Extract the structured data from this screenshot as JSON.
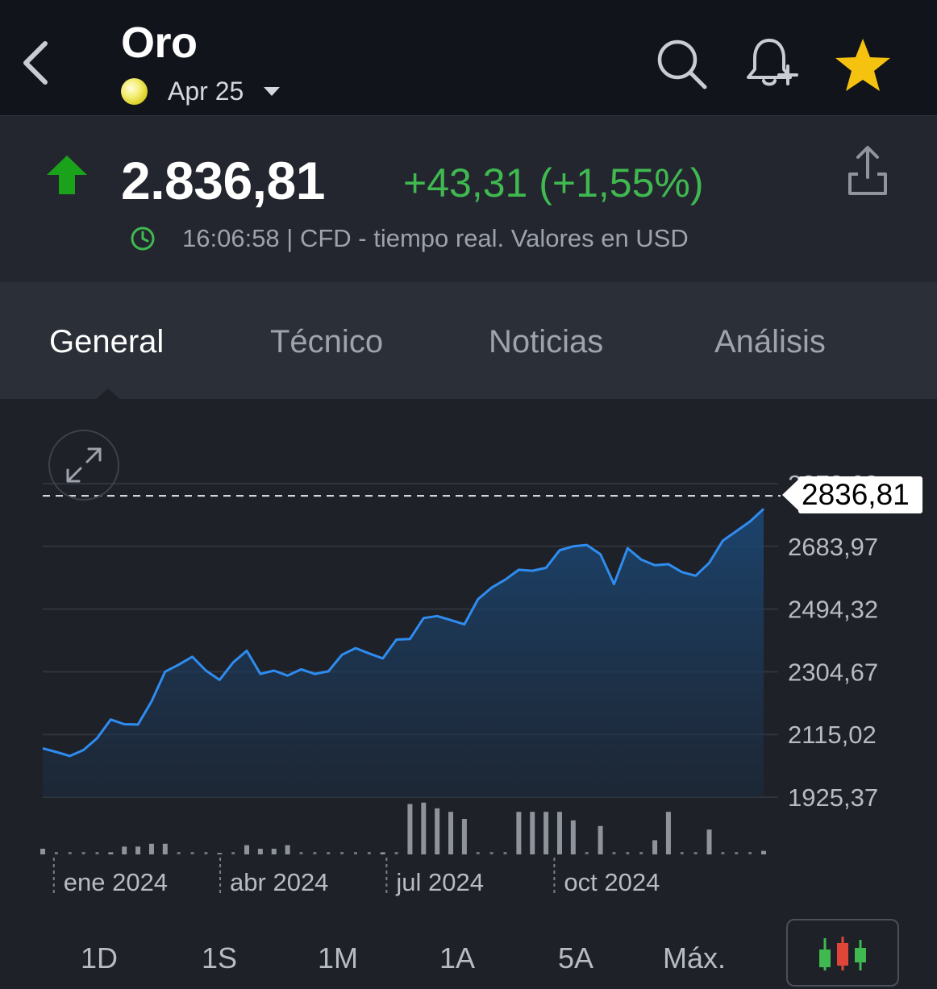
{
  "header": {
    "title": "Oro",
    "contract": "Apr 25"
  },
  "quote": {
    "price": "2.836,81",
    "change": "+43,31 (+1,55%)",
    "time_info": "16:06:58 | CFD - tiempo real. Valores en USD",
    "change_color": "#3fb950",
    "direction": "up"
  },
  "tabs": [
    "General",
    "Técnico",
    "Noticias",
    "Análisis"
  ],
  "active_tab": "General",
  "current_price_label": "2836,81",
  "chart_data": {
    "type": "area",
    "line_color": "#2f8cf0",
    "y_tick_labels": [
      "2873,62",
      "2683,97",
      "2494,32",
      "2304,67",
      "2115,02",
      "1925,37"
    ],
    "y_ticks": [
      2873.62,
      2683.97,
      2494.32,
      2304.67,
      2115.02,
      1925.37
    ],
    "ylim": [
      1925.37,
      2873.62
    ],
    "x_tick_labels": [
      "ene 2024",
      "abr 2024",
      "jul 2024",
      "oct 2024"
    ],
    "x_ticks": [
      0.8,
      12.8,
      24.8,
      36.9
    ],
    "xlim": [
      0,
      52
    ],
    "reference_line": 2836.81,
    "values": [
      2073,
      2062,
      2050,
      2068,
      2104,
      2160,
      2146,
      2145,
      2215,
      2305,
      2326,
      2350,
      2308,
      2280,
      2333,
      2368,
      2298,
      2308,
      2293,
      2312,
      2298,
      2306,
      2356,
      2376,
      2360,
      2345,
      2402,
      2404,
      2467,
      2473,
      2461,
      2448,
      2524,
      2559,
      2583,
      2613,
      2610,
      2619,
      2672,
      2684,
      2688,
      2660,
      2570,
      2678,
      2644,
      2627,
      2630,
      2606,
      2595,
      2634,
      2701,
      2730,
      2759,
      2797
    ],
    "volume": [
      0.08,
      0,
      0,
      0,
      0,
      0.03,
      0.11,
      0.11,
      0.15,
      0.15,
      0,
      0,
      0,
      0.02,
      0,
      0.13,
      0.08,
      0.08,
      0.13,
      0,
      0,
      0,
      0,
      0,
      0,
      0.03,
      0,
      0.71,
      0.73,
      0.65,
      0.6,
      0.5,
      0,
      0,
      0,
      0.6,
      0.6,
      0.6,
      0.6,
      0.48,
      0,
      0.4,
      0,
      0,
      0,
      0.2,
      0.6,
      0,
      0,
      0.35,
      0,
      0,
      0,
      0.05
    ]
  },
  "periods": [
    "1D",
    "1S",
    "1M",
    "1A",
    "5A",
    "Máx."
  ]
}
